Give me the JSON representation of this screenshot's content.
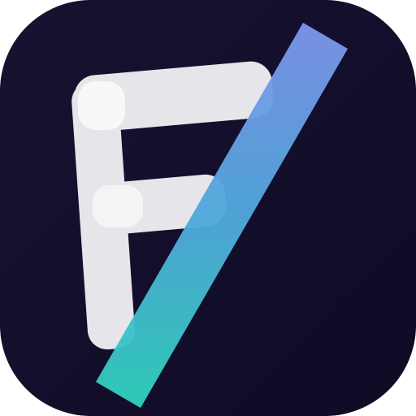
{
  "icon": {
    "name": "app-logo-icon",
    "description_name": "stylized-f-slash-logo",
    "colors": {
      "background_top": "#161230",
      "background_bottom": "#0f0b26",
      "letter_fill": "#e6e6ea",
      "letter_highlight": "#ffffff",
      "slash_gradient_start": "#7f94ec",
      "slash_gradient_mid": "#50a8db",
      "slash_gradient_end": "#2fd1bb"
    }
  }
}
